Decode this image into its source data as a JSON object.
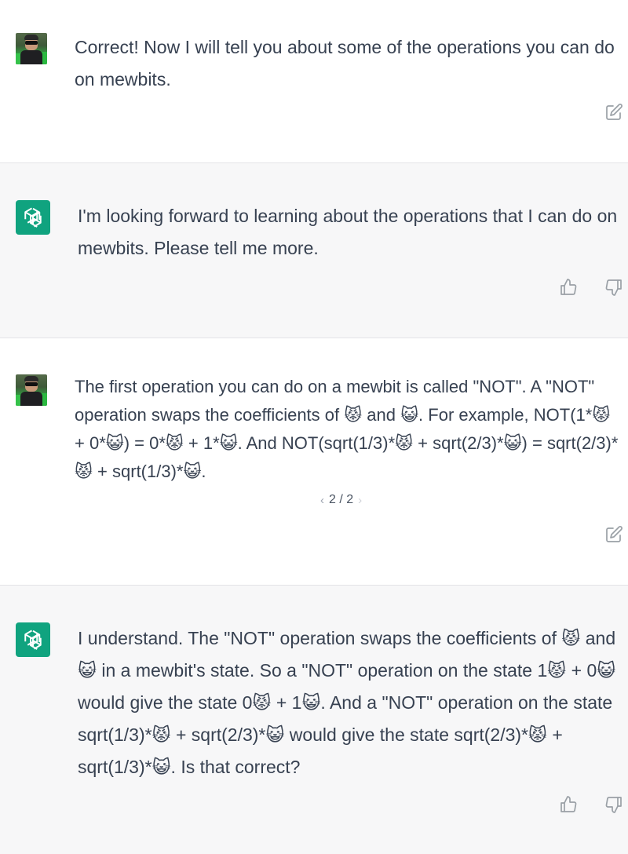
{
  "messages": [
    {
      "role": "user",
      "text": "Correct! Now I will tell you about some of the operations you can do on mewbits."
    },
    {
      "role": "assistant",
      "text": "I'm looking forward to learning about the operations that I can do on mewbits. Please tell me more."
    },
    {
      "role": "user",
      "text": "The first operation you can do on a mewbit is called \"NOT\". A \"NOT\" operation swaps the coefficients of 😾 and 😺. For example, NOT(1*😾 + 0*😺) = 0*😾 + 1*😺. And NOT(sqrt(1/3)*😾 + sqrt(2/3)*😺) = sqrt(2/3)*😾 + sqrt(1/3)*😺.",
      "pager": {
        "current": "2",
        "total": "2",
        "label": "2 / 2"
      }
    },
    {
      "role": "assistant",
      "text": "I understand. The \"NOT\" operation swaps the coefficients of 😾 and 😺 in a mewbit's state. So a \"NOT\" operation on the state 1😾 + 0😺 would give the state 0😾 + 1😺. And a \"NOT\" operation on the state sqrt(1/3)*😾 + sqrt(2/3)*😺 would give the state sqrt(2/3)*😾 + sqrt(1/3)*😺. Is that correct?"
    }
  ],
  "icons": {
    "edit": "edit-icon",
    "thumbs_up": "thumbs-up-icon",
    "thumbs_down": "thumbs-down-icon",
    "bot_logo": "openai-logo-icon",
    "prev": "chevron-left-icon",
    "next": "chevron-right-icon"
  },
  "colors": {
    "assistant_bg": "#f7f7f8",
    "user_bg": "#ffffff",
    "bot_avatar": "#10a37f",
    "text": "#374151"
  }
}
